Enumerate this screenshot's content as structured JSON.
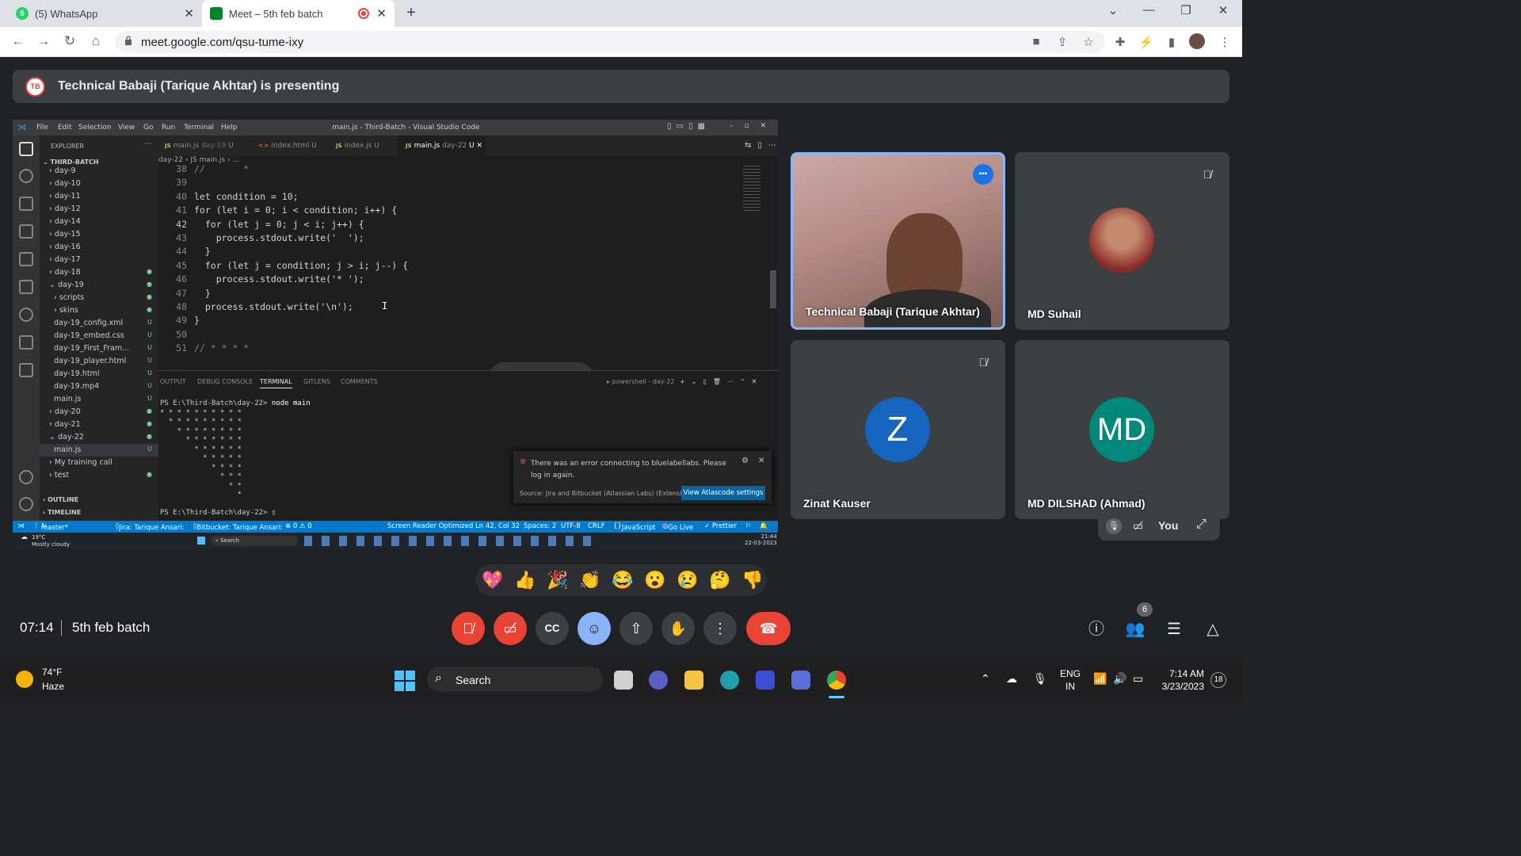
{
  "browser": {
    "tabs": [
      {
        "title": "(5) WhatsApp",
        "badge": "5"
      },
      {
        "title": "Meet – 5th feb batch"
      }
    ],
    "url": "meet.google.com/qsu-tume-ixy"
  },
  "presenting": {
    "avatar_text": "TB",
    "text": "Technical Babaji (Tarique Akhtar) is presenting"
  },
  "vscode": {
    "menu": [
      "File",
      "Edit",
      "Selection",
      "View",
      "Go",
      "Run",
      "Terminal",
      "Help"
    ],
    "title": "main.js - Third-Batch - Visual Studio Code",
    "explorer_title": "EXPLORER",
    "root": "THIRD-BATCH",
    "tree": [
      {
        "label": "day-9",
        "status": ""
      },
      {
        "label": "day-10",
        "status": ""
      },
      {
        "label": "day-11",
        "status": ""
      },
      {
        "label": "day-12",
        "status": ""
      },
      {
        "label": "day-14",
        "status": ""
      },
      {
        "label": "day-15",
        "status": ""
      },
      {
        "label": "day-16",
        "status": ""
      },
      {
        "label": "day-17",
        "status": ""
      },
      {
        "label": "day-18",
        "status": "●"
      },
      {
        "label": "day-19",
        "status": "●"
      },
      {
        "label": "scripts",
        "status": "●"
      },
      {
        "label": "skins",
        "status": "●"
      },
      {
        "label": "day-19_config.xml",
        "status": "U"
      },
      {
        "label": "day-19_embed.css",
        "status": "U"
      },
      {
        "label": "day-19_First_Fram...",
        "status": "U"
      },
      {
        "label": "day-19_player.html",
        "status": "U"
      },
      {
        "label": "day-19.html",
        "status": "U"
      },
      {
        "label": "day-19.mp4",
        "status": "U"
      },
      {
        "label": "main.js",
        "status": "U"
      },
      {
        "label": "day-20",
        "status": "●"
      },
      {
        "label": "day-21",
        "status": "●"
      },
      {
        "label": "day-22",
        "status": "●"
      },
      {
        "label": "main.js",
        "status": "U"
      },
      {
        "label": "My training call",
        "status": ""
      },
      {
        "label": "test",
        "status": "●"
      }
    ],
    "outline": "OUTLINE",
    "timeline": "TIMELINE",
    "tabs": [
      {
        "label": "main.js",
        "dir": "day-19",
        "status": "U"
      },
      {
        "label": "index.html",
        "dir": "",
        "status": "U"
      },
      {
        "label": "index.js",
        "dir": "",
        "status": "U"
      },
      {
        "label": "main.js",
        "dir": "day-22",
        "status": "U"
      }
    ],
    "breadcrumb": "day-22 › JS main.js › ...",
    "code": [
      {
        "n": "38",
        "text": "//       *"
      },
      {
        "n": "39",
        "text": ""
      },
      {
        "n": "40",
        "text": "let condition = 10;"
      },
      {
        "n": "41",
        "text": "for (let i = 0; i < condition; i++) {"
      },
      {
        "n": "42",
        "text": "  for (let j = 0; j < i; j++) {"
      },
      {
        "n": "43",
        "text": "    process.stdout.write('  ');"
      },
      {
        "n": "44",
        "text": "  }"
      },
      {
        "n": "45",
        "text": "  for (let j = condition; j > i; j--) {"
      },
      {
        "n": "46",
        "text": "    process.stdout.write('* ');"
      },
      {
        "n": "47",
        "text": "  }"
      },
      {
        "n": "48",
        "text": "  process.stdout.write('\\n');"
      },
      {
        "n": "49",
        "text": "}"
      },
      {
        "n": "50",
        "text": ""
      },
      {
        "n": "51",
        "text": "// * * * *"
      }
    ],
    "panel_tabs": [
      "OUTPUT",
      "DEBUG CONSOLE",
      "TERMINAL",
      "GITLENS",
      "COMMENTS"
    ],
    "terminal_label": "powershell - day-22",
    "terminal_prompt": "PS E:\\Third-Batch\\day-22> ",
    "terminal_command": "node main",
    "terminal_output": [
      "* * * * * * * * * *",
      "  * * * * * * * * *",
      "    * * * * * * * *",
      "      * * * * * * *",
      "        * * * * * *",
      "          * * * * *",
      "            * * * *",
      "              * * *",
      "                * *",
      "                  *"
    ],
    "terminal_last": "PS E:\\Third-Batch\\day-22> ",
    "notification": {
      "message": "There was an error connecting to bluelabellabs. Please log in again.",
      "source": "Source: Jira and Bitbucket (Atlassian Labs) (Extensi...",
      "button": "View Atlascode settings"
    },
    "status": {
      "branch": "master*",
      "jira": "Jira: Tarique Ansari:",
      "bitbucket": "Bitbucket: Tarique Ansari:",
      "problems": "⊗ 0 ⚠ 0",
      "reader": "Screen Reader Optimized",
      "position": "Ln 42, Col 32",
      "spaces": "Spaces: 2",
      "encoding": "UTF-8",
      "eol": "CRLF",
      "language": "JavaScript",
      "golive": "Go Live",
      "prettier": "✓ Prettier"
    },
    "inner_taskbar": {
      "weather": "19°C",
      "weather_desc": "Mostly cloudy",
      "search": "Search",
      "time": "21:44",
      "date": "22-03-2023"
    }
  },
  "participants": [
    {
      "name": "Technical Babaji (Tarique Akhtar)",
      "speaking": true
    },
    {
      "name": "MD Suhail",
      "muted": true
    },
    {
      "name": "Zinat Kauser",
      "initial": "Z",
      "muted": true,
      "color": "#1565c0"
    },
    {
      "name": "MD DILSHAD (Ahmad)",
      "initial": "MD",
      "color": "#00897b"
    }
  ],
  "self_label": "You",
  "reactions": [
    "💖",
    "👍",
    "🎉",
    "👏",
    "😂",
    "😮",
    "😢",
    "🤔",
    "👎"
  ],
  "meeting": {
    "time": "07:14",
    "name": "5th feb batch",
    "people_count": "6"
  },
  "colors": {
    "meet_bg": "#202124",
    "end_call": "#ea4335",
    "accent": "#8ab4f8"
  },
  "taskbar": {
    "temperature": "74°F",
    "weather": "Haze",
    "search": "Search",
    "lang1": "ENG",
    "lang2": "IN",
    "time": "7:14 AM",
    "date": "3/23/2023",
    "notifications": "18"
  }
}
